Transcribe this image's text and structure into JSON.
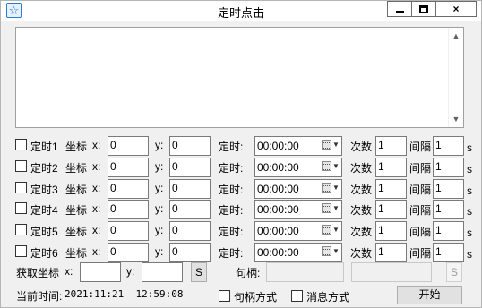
{
  "window": {
    "title": "定时点击",
    "icon": "star-icon",
    "controls": {
      "minimize": "minimize-icon",
      "maximize": "maximize-icon",
      "close": "×"
    }
  },
  "log": {
    "value": ""
  },
  "rows": [
    {
      "label": "定时1",
      "checked": false,
      "coord_label": "坐标",
      "x_label": "x:",
      "x": "0",
      "y_label": "y:",
      "y": "0",
      "time_label": "定时:",
      "time": "00:00:00",
      "count_label": "次数",
      "count": "1",
      "interval_label": "间隔",
      "interval": "1",
      "unit": "s"
    },
    {
      "label": "定时2",
      "checked": false,
      "coord_label": "坐标",
      "x_label": "x:",
      "x": "0",
      "y_label": "y:",
      "y": "0",
      "time_label": "定时:",
      "time": "00:00:00",
      "count_label": "次数",
      "count": "1",
      "interval_label": "间隔",
      "interval": "1",
      "unit": "s"
    },
    {
      "label": "定时3",
      "checked": false,
      "coord_label": "坐标",
      "x_label": "x:",
      "x": "0",
      "y_label": "y:",
      "y": "0",
      "time_label": "定时:",
      "time": "00:00:00",
      "count_label": "次数",
      "count": "1",
      "interval_label": "间隔",
      "interval": "1",
      "unit": "s"
    },
    {
      "label": "定时4",
      "checked": false,
      "coord_label": "坐标",
      "x_label": "x:",
      "x": "0",
      "y_label": "y:",
      "y": "0",
      "time_label": "定时:",
      "time": "00:00:00",
      "count_label": "次数",
      "count": "1",
      "interval_label": "间隔",
      "interval": "1",
      "unit": "s"
    },
    {
      "label": "定时5",
      "checked": false,
      "coord_label": "坐标",
      "x_label": "x:",
      "x": "0",
      "y_label": "y:",
      "y": "0",
      "time_label": "定时:",
      "time": "00:00:00",
      "count_label": "次数",
      "count": "1",
      "interval_label": "间隔",
      "interval": "1",
      "unit": "s"
    },
    {
      "label": "定时6",
      "checked": false,
      "coord_label": "坐标",
      "x_label": "x:",
      "x": "0",
      "y_label": "y:",
      "y": "0",
      "time_label": "定时:",
      "time": "00:00:00",
      "count_label": "次数",
      "count": "1",
      "interval_label": "间隔",
      "interval": "1",
      "unit": "s"
    }
  ],
  "get_coords": {
    "label": "获取坐标",
    "x_label": "x:",
    "x": "",
    "y_label": "y:",
    "y": "",
    "s_button": "S",
    "handle_label": "句柄:",
    "handle": "",
    "handle2": "",
    "s_button2": "S"
  },
  "footer": {
    "current_time_label": "当前时间:",
    "current_time": "2021:11:21  12:59:08",
    "handle_mode_label": "句柄方式",
    "handle_mode_checked": false,
    "message_mode_label": "消息方式",
    "message_mode_checked": false,
    "start_button": "开始"
  }
}
